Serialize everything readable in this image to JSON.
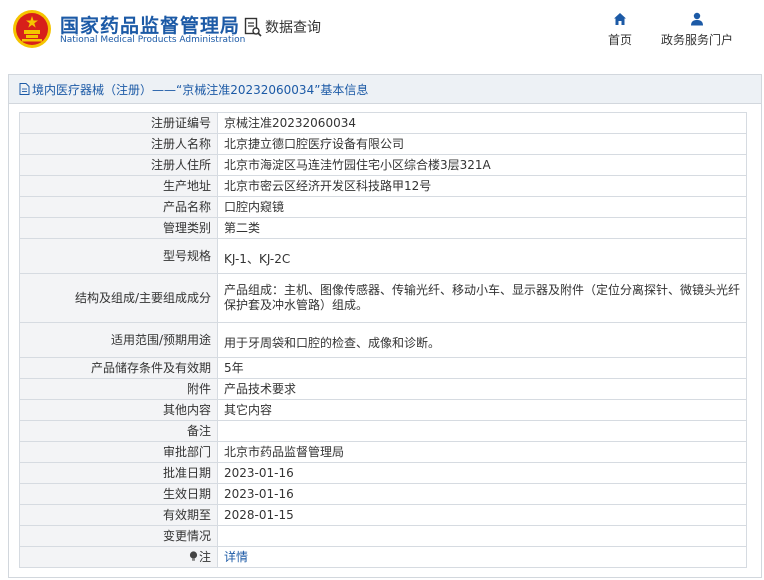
{
  "header": {
    "brand_cn": "国家药品监督管理局",
    "brand_en": "National Medical Products Administration",
    "query_label": "数据查询",
    "nav": [
      {
        "label": "首页",
        "icon": "home-icon"
      },
      {
        "label": "政务服务门户",
        "icon": "user-icon"
      }
    ]
  },
  "panel": {
    "title": "境内医疗器械（注册）——“京械注准20232060034”基本信息"
  },
  "rows": [
    {
      "key": "注册证编号",
      "value": "京械注准20232060034"
    },
    {
      "key": "注册人名称",
      "value": "北京捷立德口腔医疗设备有限公司"
    },
    {
      "key": "注册人住所",
      "value": "北京市海淀区马连洼竹园住宅小区综合楼3层321A"
    },
    {
      "key": "生产地址",
      "value": "北京市密云区经济开发区科技路甲12号"
    },
    {
      "key": "产品名称",
      "value": "口腔内窥镜"
    },
    {
      "key": "管理类别",
      "value": "第二类"
    },
    {
      "key": "型号规格",
      "value": "KJ-1、KJ-2C"
    },
    {
      "key": "结构及组成/主要组成成分",
      "value": "产品组成：主机、图像传感器、传输光纤、移动小车、显示器及附件（定位分离探针、微镜头光纤保护套及冲水管路）组成。"
    },
    {
      "key": "适用范围/预期用途",
      "value": "用于牙周袋和口腔的检查、成像和诊断。"
    },
    {
      "key": "产品储存条件及有效期",
      "value": "5年"
    },
    {
      "key": "附件",
      "value": "产品技术要求"
    },
    {
      "key": "其他内容",
      "value": "其它内容"
    },
    {
      "key": "备注",
      "value": ""
    },
    {
      "key": "审批部门",
      "value": "北京市药品监督管理局"
    },
    {
      "key": "批准日期",
      "value": "2023-01-16"
    },
    {
      "key": "生效日期",
      "value": "2023-01-16"
    },
    {
      "key": "有效期至",
      "value": "2028-01-15"
    },
    {
      "key": "变更情况",
      "value": ""
    },
    {
      "key": "注",
      "value": "详情"
    }
  ],
  "colors": {
    "brand": "#1c5aa6",
    "logo_red": "#d7201a",
    "logo_gold": "#f5c400"
  }
}
